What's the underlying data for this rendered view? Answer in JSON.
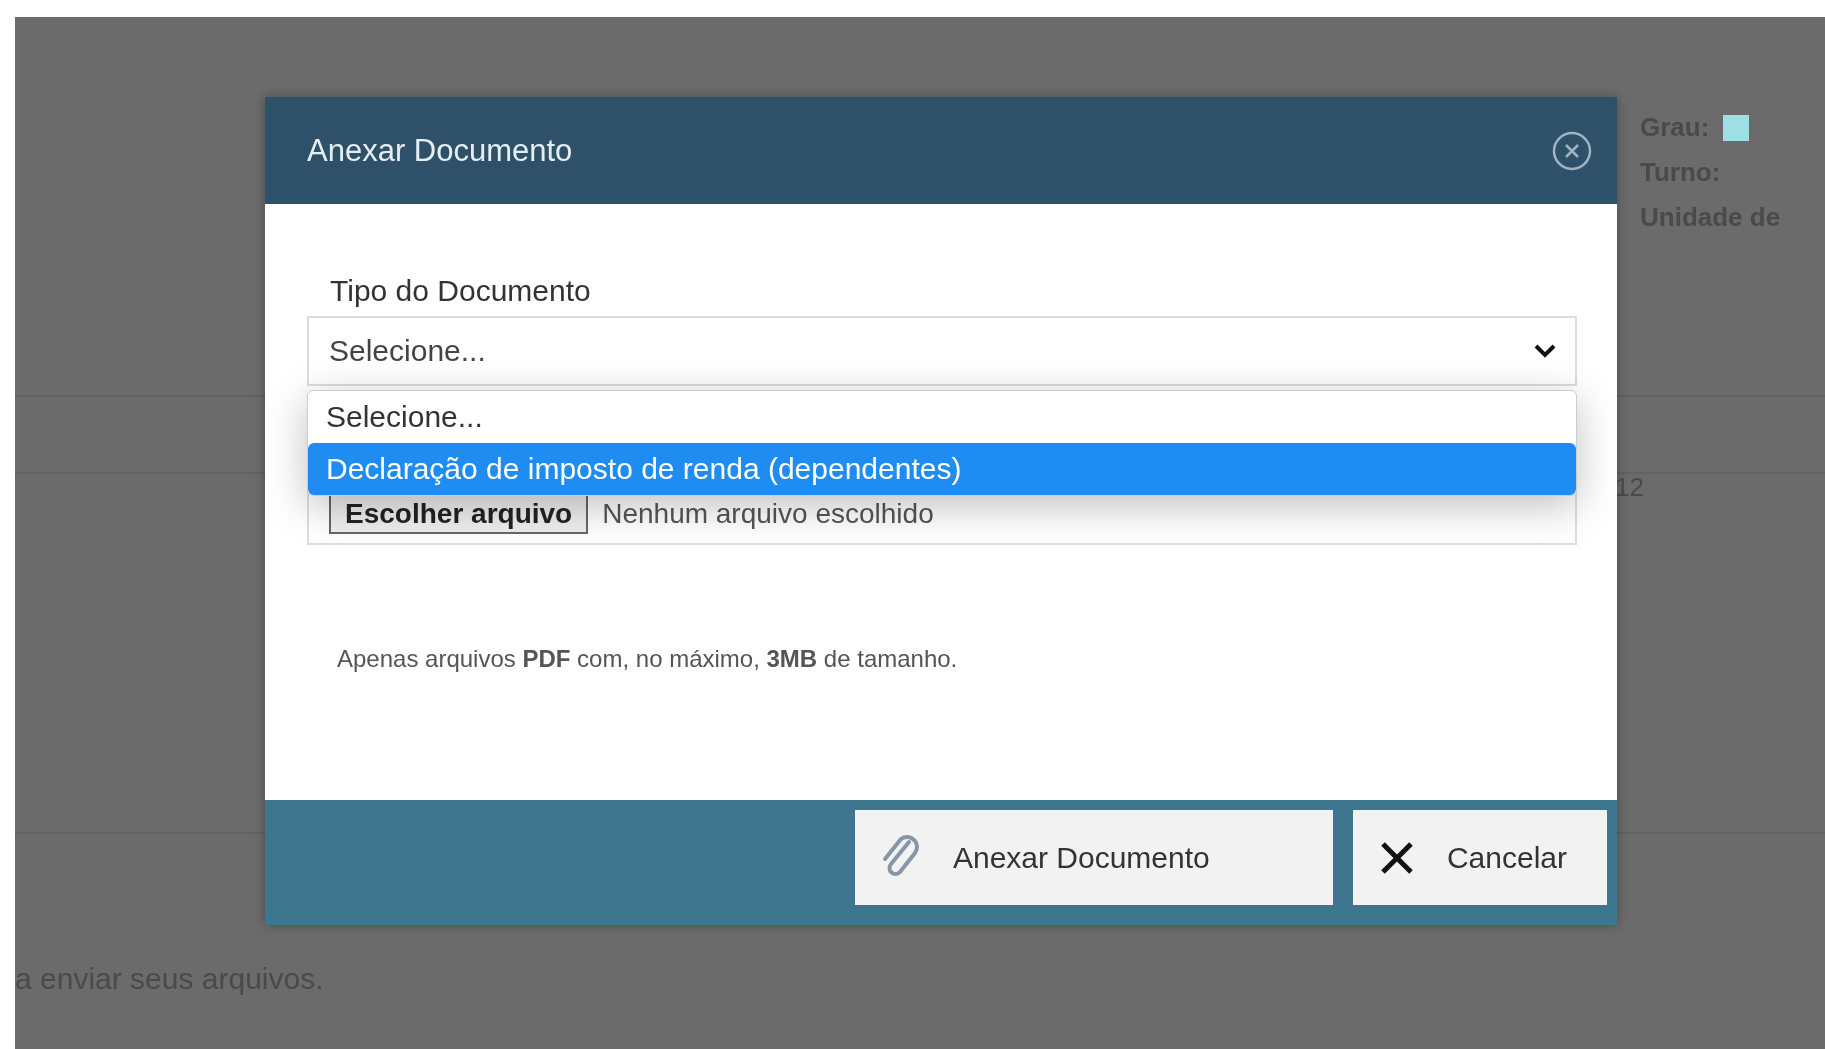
{
  "page": {
    "side_info": [
      "Grau:",
      "Turno:",
      "Unidade de"
    ],
    "row_value": "12",
    "footer_text": "a enviar seus arquivos."
  },
  "dialog": {
    "title": "Anexar Documento",
    "field_label": "Tipo do Documento",
    "select": {
      "value": "Selecione...",
      "expanded": true,
      "options": [
        {
          "label": "Selecione...",
          "highlighted": false
        },
        {
          "label": "Declaração de imposto de renda (dependentes)",
          "highlighted": true
        }
      ]
    },
    "file_button": "Escolher arquivo",
    "file_status": "Nenhum arquivo escolhido",
    "hint": "Apenas arquivos **PDF** com, no máximo, **3MB** de tamanho.",
    "buttons": [
      {
        "kind": "attach",
        "label": "Anexar Documento"
      },
      {
        "kind": "cancel",
        "label": "Cancelar"
      }
    ]
  }
}
